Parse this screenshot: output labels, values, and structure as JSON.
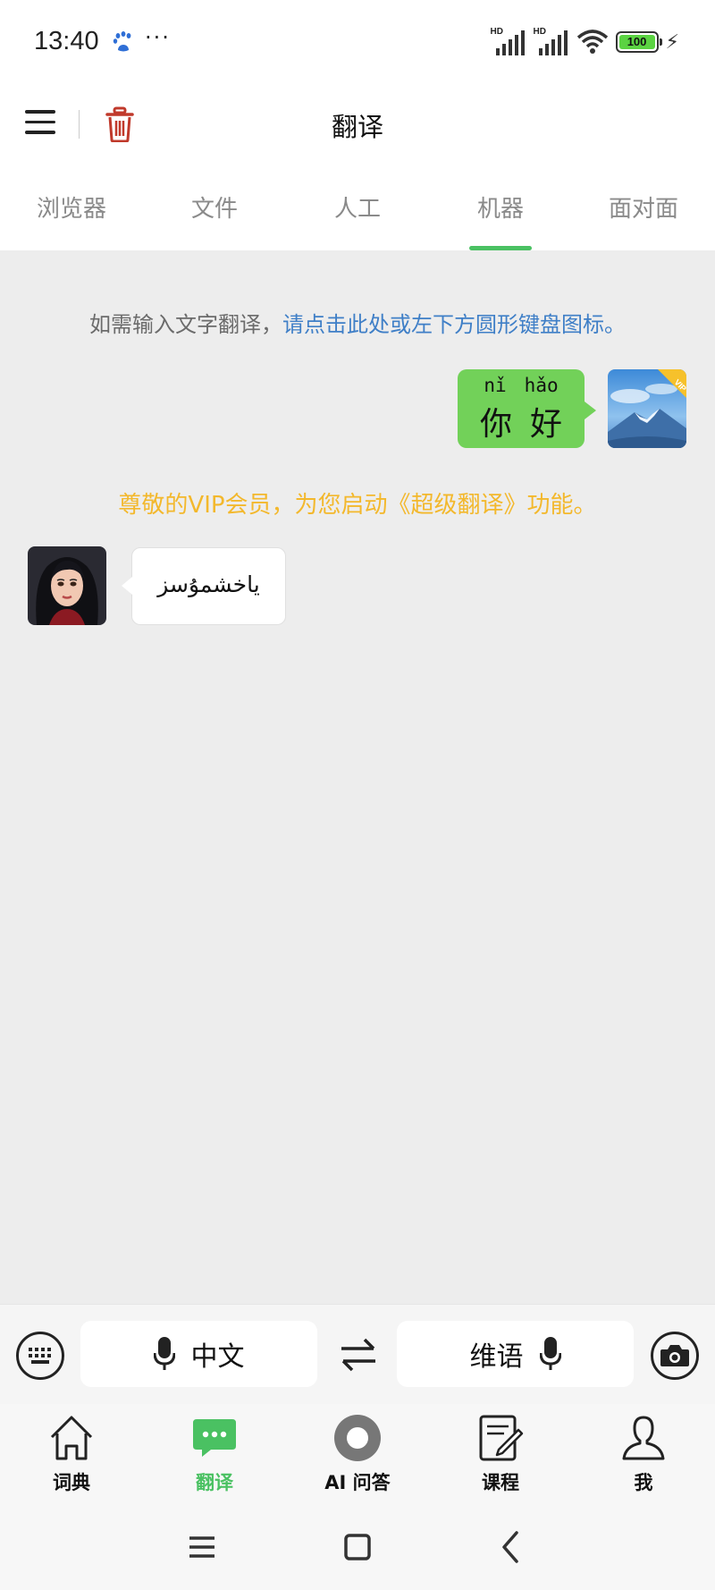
{
  "status_bar": {
    "time": "13:40",
    "dots": "···",
    "signal_1_label": "HD",
    "signal_2_label": "HD",
    "battery_level": "100",
    "icons": [
      "baidu-paw-icon",
      "signal-icon",
      "wifi-icon",
      "battery-icon",
      "charging-icon"
    ]
  },
  "header": {
    "title": "翻译",
    "menu_icon": "menu-icon",
    "delete_icon": "trash-icon",
    "accent_delete": "#c0392b"
  },
  "tabs": [
    {
      "label": "浏览器",
      "active": false
    },
    {
      "label": "文件",
      "active": false
    },
    {
      "label": "人工",
      "active": false
    },
    {
      "label": "机器",
      "active": true
    },
    {
      "label": "面对面",
      "active": false
    }
  ],
  "chat": {
    "hint_prefix": "如需输入文字翻译，",
    "hint_link": "请点击此处或左下方圆形键盘图标。",
    "user_message": {
      "pinyin": [
        "nǐ",
        "hǎo"
      ],
      "hanzi": [
        "你",
        "好"
      ],
      "badge": "VIP"
    },
    "vip_notice": "尊敬的VIP会员，为您启动《超级翻译》功能。",
    "bot_message": "ياخشمۇسز"
  },
  "input_bar": {
    "source_lang": "中文",
    "target_lang": "维语",
    "icons": [
      "keyboard-icon",
      "mic-icon",
      "swap-icon",
      "camera-icon"
    ]
  },
  "bottom_nav": [
    {
      "label": "词典",
      "icon": "home-icon",
      "active": false
    },
    {
      "label": "翻译",
      "icon": "chat-icon",
      "active": true
    },
    {
      "label": "AI 问答",
      "icon": "ai-circle-icon",
      "active": false
    },
    {
      "label": "课程",
      "icon": "edit-icon",
      "active": false
    },
    {
      "label": "我",
      "icon": "person-icon",
      "active": false
    }
  ],
  "colors": {
    "accent_green": "#4ac162",
    "bubble_green": "#72d159",
    "link_blue": "#3f7fc7",
    "vip_yellow": "#f3b82c",
    "background": "#ededed"
  }
}
